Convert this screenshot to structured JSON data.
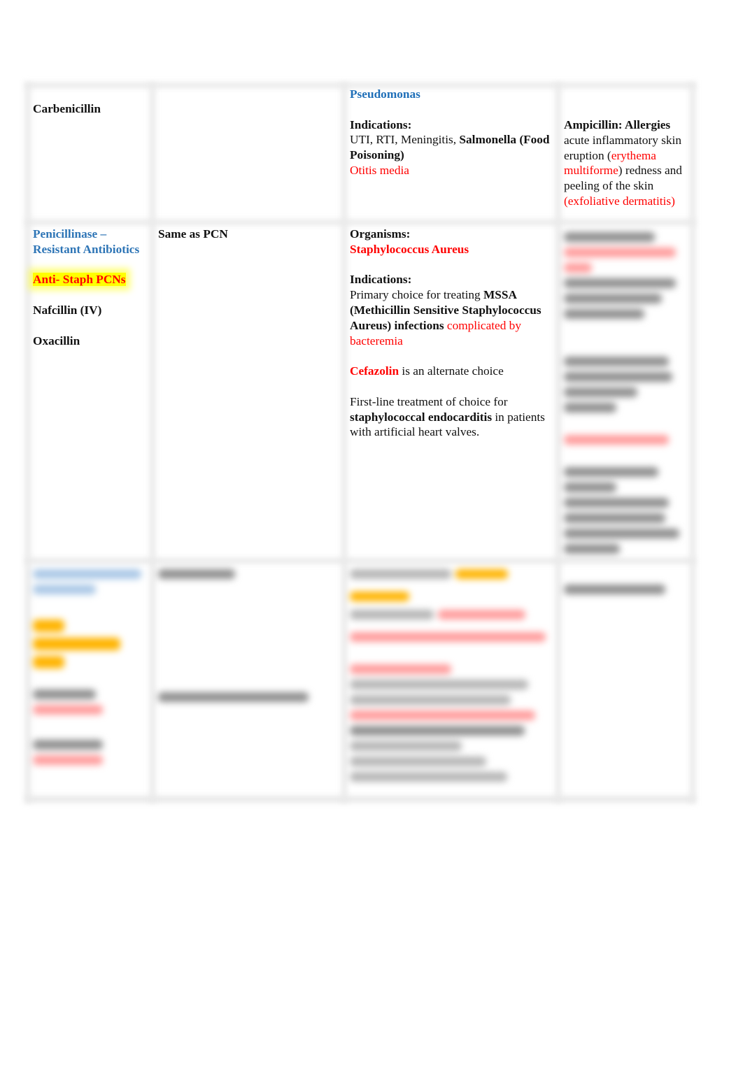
{
  "document": {
    "table": {
      "rows": [
        {
          "drug": {
            "name": "Carbenicillin"
          },
          "mechanism": {
            "text": ""
          },
          "uses": {
            "organism_heading": "Pseudomonas",
            "indications_label": "Indications:",
            "indications_plain": "UTI, RTI, Meningitis, ",
            "indications_bold": "Salmonella (Food Poisoning)",
            "indications_red": "Otitis media"
          },
          "adverse": {
            "heading": "Ampicillin: Allergies",
            "line1": "acute inflammatory skin eruption",
            "paren_open": "(",
            "erythema": "erythema multiforme",
            "paren_close": ")",
            "line2": "redness and peeling of the skin ",
            "exfoliative": "(exfoliative dermatitis)"
          }
        },
        {
          "drug": {
            "class_name": "Penicillinase – Resistant Antibiotics",
            "highlight": "Anti- Staph PCNs",
            "items": [
              "Nafcillin (IV)",
              "Oxacillin"
            ]
          },
          "mechanism": {
            "text": "Same as PCN"
          },
          "uses": {
            "organisms_label": "Organisms:",
            "organism": "Staphylococcus Aureus",
            "indications_label": "Indications:",
            "primary_plain": "Primary choice for treating ",
            "primary_bold": "MSSA (Methicillin Sensitive Staphylococcus Aureus) infections",
            "primary_red": "complicated by bacteremia",
            "alt_red": "Cefazolin",
            "alt_plain": " is an alternate choice",
            "firstline_plain": "First-line treatment of choice for ",
            "firstline_bold": "staphylococcal endocarditis",
            "firstline_end": " in patients with artificial heart valves."
          },
          "adverse": {
            "blurred": true
          }
        },
        {
          "drug": {
            "blurred": true
          },
          "mechanism": {
            "blurred": true
          },
          "uses": {
            "blurred": true
          },
          "adverse": {
            "blurred": true
          }
        }
      ]
    }
  }
}
